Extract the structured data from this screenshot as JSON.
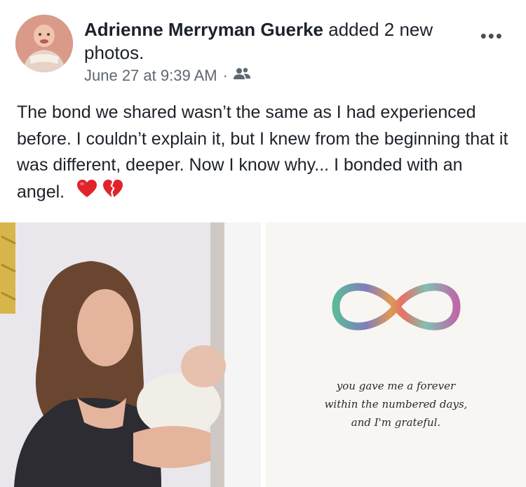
{
  "post": {
    "author": "Adrienne Merryman Guerke",
    "action": " added 2 new photos.",
    "timestamp": "June 27 at 9:39 AM",
    "separator": "·",
    "audience_icon": "friends-icon",
    "more_icon": "more-options-icon",
    "text": "The bond we shared wasn’t the same as I had experienced before. I couldn’t explain it, but I knew from the beginning that it was different, deeper. Now I know why... I bonded with an angel.",
    "emoji": [
      "red-heart",
      "broken-heart"
    ]
  },
  "photos": [
    {
      "description_icon": "mother-holding-baby-photo"
    },
    {
      "quote_lines": [
        "you gave me a forever",
        "within the numbered days,",
        "and I'm grateful."
      ]
    }
  ],
  "colors": {
    "text": "#1d2129",
    "meta": "#606770",
    "heart": "#e0242b"
  }
}
